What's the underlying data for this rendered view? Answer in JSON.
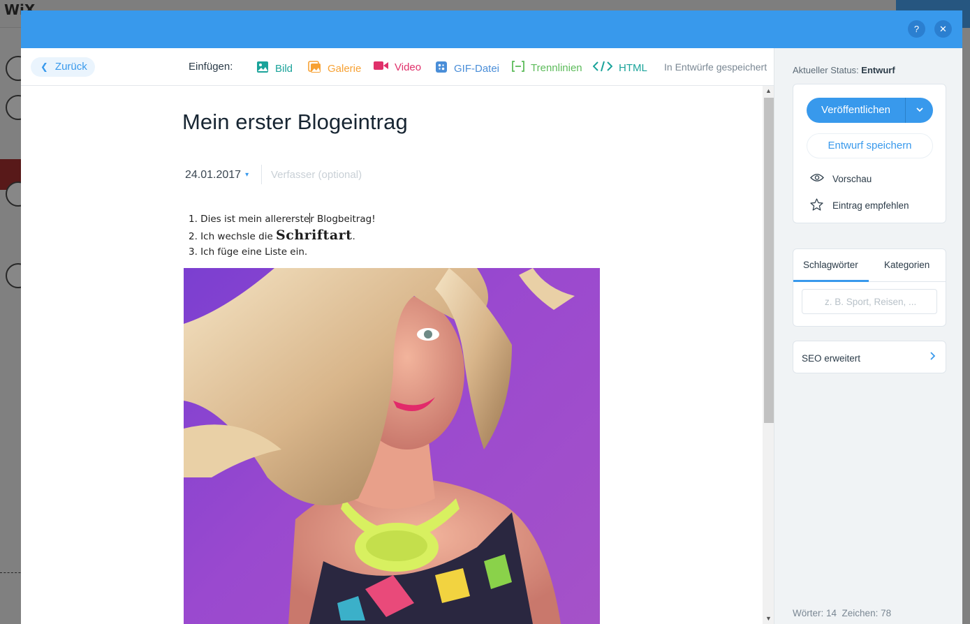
{
  "background": {
    "logo": "WiX"
  },
  "modal": {
    "help_label": "?",
    "close_label": "✕"
  },
  "toolbar": {
    "back_label": "Zurück",
    "insert_label": "Einfügen:",
    "tools": [
      {
        "label": "Bild",
        "color": "#1aa39a",
        "icon": "image-icon"
      },
      {
        "label": "Galerie",
        "color": "#f7a133",
        "icon": "gallery-icon"
      },
      {
        "label": "Video",
        "color": "#e0306a",
        "icon": "video-icon"
      },
      {
        "label": "GIF-Datei",
        "color": "#4a8ed8",
        "icon": "gif-icon"
      },
      {
        "label": "Trennlinien",
        "color": "#5cbb5a",
        "icon": "divider-icon"
      },
      {
        "label": "HTML",
        "color": "#1aa39a",
        "icon": "code-icon"
      }
    ],
    "saved_status": "In Entwürfe gespeichert"
  },
  "post": {
    "title": "Mein erster Blogeintrag",
    "date": "24.01.2017",
    "author_placeholder": "Verfasser (optional)",
    "list": [
      {
        "before": "Dies ist mein allererste",
        "after": "r Blogbeitrag!"
      },
      {
        "before": "Ich wechsle die ",
        "fancy": "Schriftart",
        "after": "."
      },
      {
        "before": "Ich füge eine Liste ein."
      }
    ]
  },
  "panel": {
    "status_label": "Aktueller Status:",
    "status_value": "Entwurf",
    "publish_label": "Veröffentlichen",
    "draft_label": "Entwurf speichern",
    "preview_label": "Vorschau",
    "recommend_label": "Eintrag empfehlen",
    "tab_tags": "Schlagwörter",
    "tab_categories": "Kategorien",
    "tags_placeholder": "z. B. Sport, Reisen, ...",
    "seo_label": "SEO erweitert",
    "words_label": "Wörter: 14",
    "chars_label": "Zeichen: 78"
  },
  "colors": {
    "accent": "#3899ec",
    "header": "#3899ec"
  }
}
